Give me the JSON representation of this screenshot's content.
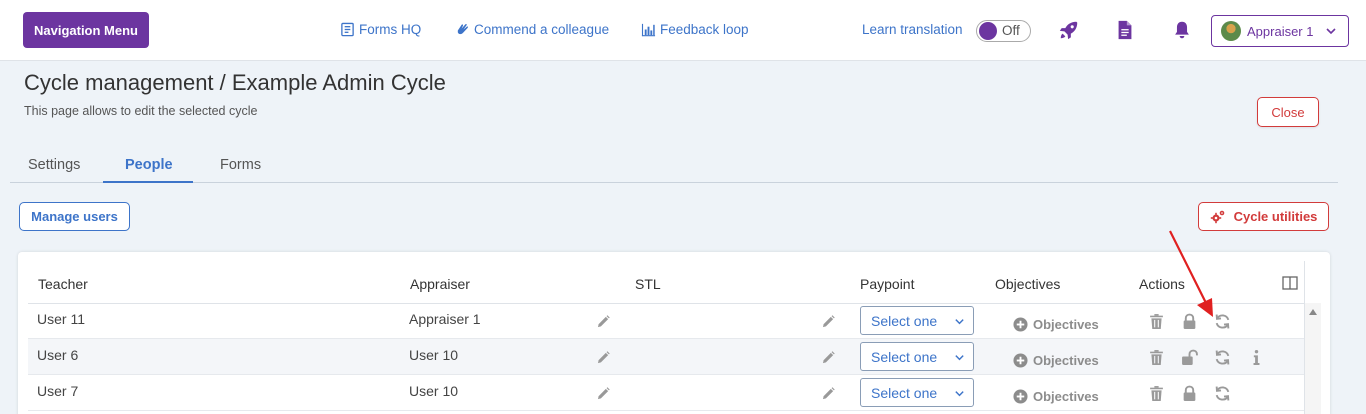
{
  "header": {
    "nav_menu_label": "Navigation Menu",
    "links": [
      {
        "label": "Forms HQ",
        "icon": "form-icon"
      },
      {
        "label": "Commend a colleague",
        "icon": "clap-icon"
      },
      {
        "label": "Feedback loop",
        "icon": "bar-chart-icon"
      }
    ],
    "learn_translation_label": "Learn translation",
    "toggle_state": "Off",
    "icons": [
      "rocket-icon",
      "document-icon",
      "bell-icon"
    ],
    "user_label": "Appraiser 1",
    "accent_color": "#6c35a0"
  },
  "page": {
    "title": "Cycle management / Example Admin Cycle",
    "subtitle": "This page allows to edit the selected cycle",
    "close_label": "Close"
  },
  "tabs": [
    {
      "label": "Settings",
      "active": false
    },
    {
      "label": "People",
      "active": true
    },
    {
      "label": "Forms",
      "active": false
    }
  ],
  "toolbar": {
    "manage_users_label": "Manage users",
    "cycle_utilities_label": "Cycle utilities"
  },
  "table": {
    "columns": [
      "Teacher",
      "Appraiser",
      "STL",
      "Paypoint",
      "Objectives",
      "Actions"
    ],
    "rows": [
      {
        "teacher": "User 11",
        "appraiser": "Appraiser 1",
        "stl": "",
        "paypoint": "Select one",
        "objectives": "Objectives",
        "locked": true,
        "info": false
      },
      {
        "teacher": "User 6",
        "appraiser": "User 10",
        "stl": "",
        "paypoint": "Select one",
        "objectives": "Objectives",
        "locked": false,
        "info": true
      },
      {
        "teacher": "User 7",
        "appraiser": "User 10",
        "stl": "",
        "paypoint": "Select one",
        "objectives": "Objectives",
        "locked": true,
        "info": false
      }
    ]
  },
  "colors": {
    "link": "#3d74c9",
    "danger": "#d23b3b",
    "annotation_arrow": "#e02020"
  }
}
